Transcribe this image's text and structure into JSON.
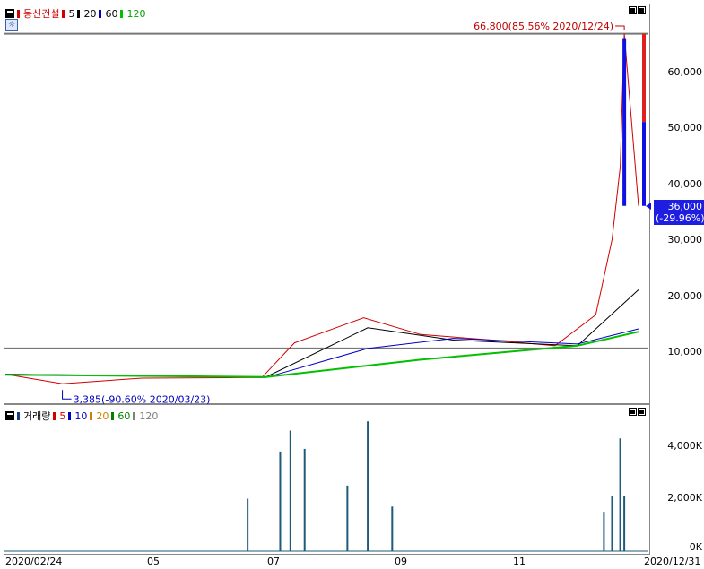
{
  "price_panel": {
    "stock_name": "동신건설",
    "ma_labels": [
      "5",
      "20",
      "60",
      "120"
    ],
    "ma_colors": [
      "#d00000",
      "#000000",
      "#0000c0",
      "#00c000"
    ],
    "high_annotation": "66,800(85.56% 2020/12/24)",
    "low_annotation": "3,385(-90.60% 2020/03/23)",
    "current_price": "36,000",
    "current_change": "(-29.96%)",
    "y_ticks": [
      "60,000",
      "50,000",
      "40,000",
      "30,000",
      "20,000",
      "10,000"
    ]
  },
  "volume_panel": {
    "title": "거래량",
    "ma_labels": [
      "5",
      "10",
      "20",
      "60",
      "120"
    ],
    "ma_colors": [
      "#d00000",
      "#0000c0",
      "#d08000",
      "#008000",
      "#808080"
    ],
    "y_ticks": [
      "4,000K",
      "2,000K",
      "0K"
    ]
  },
  "x_axis": {
    "start_label": "2020/02/24",
    "month_labels": [
      "05",
      "07",
      "09",
      "11"
    ],
    "end_label": "2020/12/31"
  },
  "chart_data": [
    {
      "type": "line",
      "title": "동신건설",
      "series": [
        {
          "name": "5",
          "x": [
            "2020/02/24",
            "2020/03/23",
            "2020/05/01",
            "2020/06/29",
            "2020/07/15",
            "2020/08/18",
            "2020/09/15",
            "2020/10/20",
            "2020/11/20",
            "2020/12/10",
            "2020/12/18",
            "2020/12/22",
            "2020/12/24",
            "2020/12/31"
          ],
          "values": [
            5900,
            4200,
            5200,
            5300,
            11500,
            16000,
            13000,
            12000,
            11000,
            16500,
            30000,
            43000,
            66800,
            36000
          ]
        },
        {
          "name": "20",
          "x": [
            "2020/02/24",
            "2020/07/01",
            "2020/08/20",
            "2020/10/01",
            "2020/12/01",
            "2020/12/31"
          ],
          "values": [
            5900,
            5400,
            14200,
            12000,
            11000,
            21000
          ]
        },
        {
          "name": "60",
          "x": [
            "2020/02/24",
            "2020/07/01",
            "2020/08/20",
            "2020/10/01",
            "2020/12/01",
            "2020/12/31"
          ],
          "values": [
            5900,
            5300,
            10500,
            12300,
            11300,
            14000
          ]
        },
        {
          "name": "120",
          "x": [
            "2020/02/24",
            "2020/07/01",
            "2020/09/15",
            "2020/12/01",
            "2020/12/31"
          ],
          "values": [
            5800,
            5400,
            8500,
            11000,
            13500
          ]
        }
      ],
      "annotations": [
        "66,800(85.56% 2020/12/24)",
        "3,385(-90.60% 2020/03/23)",
        "36,000",
        "(-29.96%)"
      ],
      "reference_lines": [
        66800,
        10500
      ],
      "ylim": [
        0,
        70000
      ]
    },
    {
      "type": "bar",
      "title": "거래량",
      "x": [
        "2020/06/22",
        "2020/07/08",
        "2020/07/13",
        "2020/07/20",
        "2020/08/10",
        "2020/08/20",
        "2020/09/01",
        "2020/12/14",
        "2020/12/18",
        "2020/12/22",
        "2020/12/24"
      ],
      "values": [
        2000,
        3800,
        4600,
        3900,
        2500,
        4950,
        1700,
        1500,
        2100,
        4300,
        2100
      ],
      "ylim": [
        0,
        5000
      ],
      "unit": "K"
    }
  ]
}
